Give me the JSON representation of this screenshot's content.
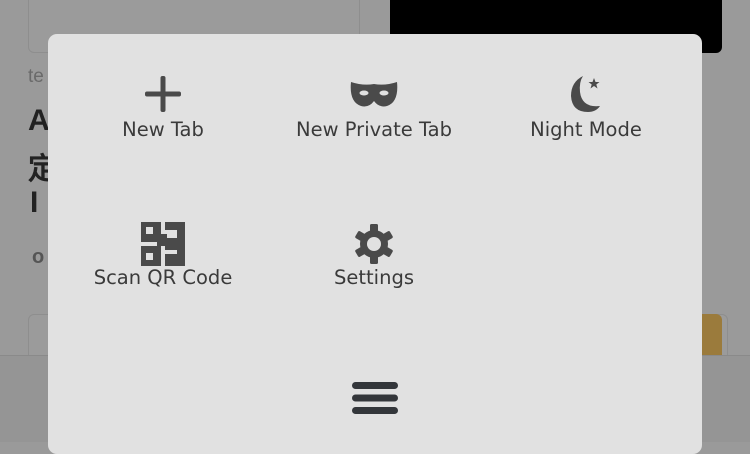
{
  "background": {
    "fragment_small": "te",
    "fragment_title_1": "A",
    "fragment_title_2": "定",
    "fragment_title_3": "I",
    "fragment_meta": "o"
  },
  "menu": {
    "items": [
      {
        "label": "New Tab",
        "icon": "plus-icon"
      },
      {
        "label": "New Private Tab",
        "icon": "mask-icon"
      },
      {
        "label": "Night Mode",
        "icon": "moon-star-icon"
      },
      {
        "label": "Scan QR Code",
        "icon": "qr-code-icon"
      },
      {
        "label": "Settings",
        "icon": "gear-icon"
      }
    ],
    "toggle_icon": "hamburger-icon"
  },
  "colors": {
    "panel": "#e1e1e1",
    "icon": "#4a4a4a",
    "overlay": "#9a9a9a",
    "accent": "#9b7b3c"
  }
}
